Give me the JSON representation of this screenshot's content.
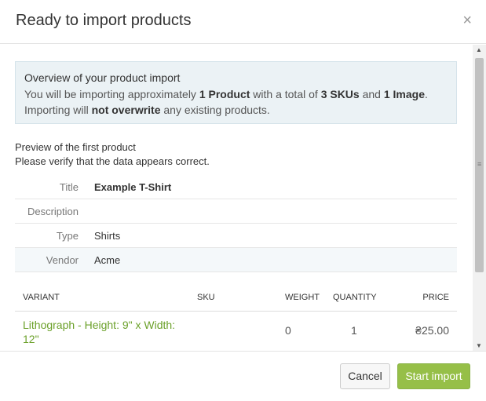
{
  "dialog": {
    "title": "Ready to import products",
    "close_glyph": "×"
  },
  "overview": {
    "heading": "Overview of your product import",
    "line1_prefix": "You will be importing approximately ",
    "product_count": "1 Product",
    "line1_mid": " with a total of ",
    "sku_count": "3 SKUs",
    "line1_and": " and ",
    "image_count": "1 Image",
    "line1_end": ".",
    "line2_prefix": "Importing will ",
    "line2_emphasis": "not overwrite",
    "line2_suffix": " any existing products."
  },
  "preview": {
    "heading": "Preview of the first product",
    "subheading": "Please verify that the data appears correct.",
    "fields": [
      {
        "label": "Title",
        "value": "Example T-Shirt"
      },
      {
        "label": "Description",
        "value": ""
      },
      {
        "label": "Type",
        "value": "Shirts"
      },
      {
        "label": "Vendor",
        "value": "Acme"
      }
    ]
  },
  "variants": {
    "columns": [
      "VARIANT",
      "SKU",
      "WEIGHT",
      "QUANTITY",
      "PRICE"
    ],
    "rows": [
      {
        "variant": "Lithograph - Height: 9\" x Width: 12\"",
        "sku": "",
        "weight": "0",
        "quantity": "1",
        "price": "₴25.00"
      }
    ]
  },
  "footer": {
    "cancel_label": "Cancel",
    "start_label": "Start import"
  },
  "scrollbar": {
    "up": "▲",
    "down": "▼",
    "grip": "≡"
  },
  "colors": {
    "accent_green": "#96bf48",
    "link_green": "#6ca12b",
    "info_bg": "#ebf2f5"
  }
}
